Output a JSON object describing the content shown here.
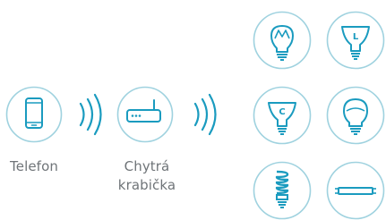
{
  "colors": {
    "circle_stroke": "#9fd2df",
    "icon_stroke": "#1a9bbf",
    "text": "#6f7478",
    "background": "#ffffff"
  },
  "devices": {
    "phone": {
      "icon": "smartphone-icon",
      "label": "Telefon"
    },
    "hub": {
      "icon": "router-icon",
      "label_line1": "Chytrá",
      "label_line2": "krabička"
    }
  },
  "signals": [
    {
      "icon": "wireless-signal-icon"
    },
    {
      "icon": "wireless-signal-icon"
    }
  ],
  "bulbs": [
    {
      "icon": "led-bulb-icon",
      "mark": ""
    },
    {
      "icon": "spot-bulb-icon",
      "mark": "L"
    },
    {
      "icon": "spot-bulb-icon",
      "mark": "C"
    },
    {
      "icon": "globe-bulb-icon",
      "mark": ""
    },
    {
      "icon": "spiral-cfl-bulb-icon",
      "mark": ""
    },
    {
      "icon": "fluorescent-tube-icon",
      "mark": ""
    }
  ]
}
